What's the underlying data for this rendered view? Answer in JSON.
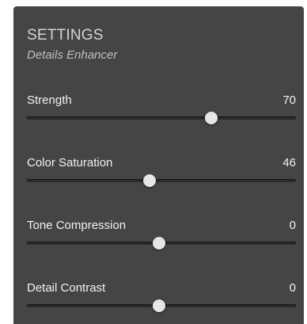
{
  "panel": {
    "title": "SETTINGS",
    "subtitle": "Details Enhancer"
  },
  "sliders": [
    {
      "label": "Strength",
      "value": "70",
      "position": 0.685
    },
    {
      "label": "Color Saturation",
      "value": "46",
      "position": 0.455
    },
    {
      "label": "Tone Compression",
      "value": "0",
      "position": 0.49
    },
    {
      "label": "Detail Contrast",
      "value": "0",
      "position": 0.49
    }
  ]
}
